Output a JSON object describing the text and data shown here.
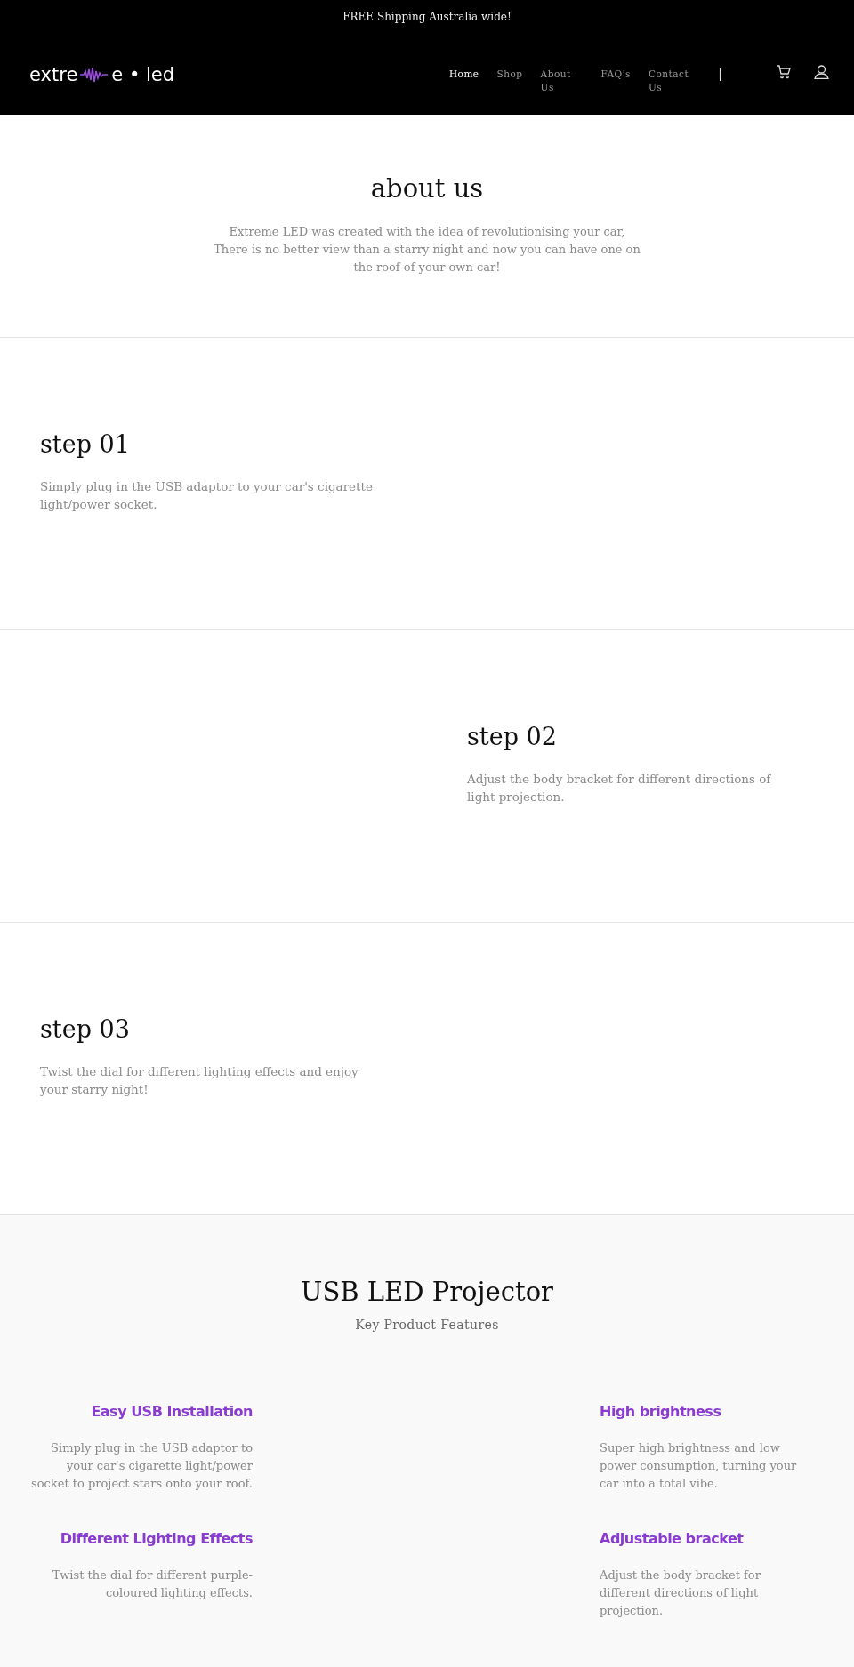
{
  "announcement": "FREE Shipping Australia wide!",
  "logo": {
    "before": "extre",
    "after": "e • led"
  },
  "nav": [
    {
      "label": "Home",
      "selected": true
    },
    {
      "label": "Shop",
      "selected": false
    },
    {
      "label": "About Us",
      "selected": false
    },
    {
      "label": "FAQ's",
      "selected": false
    },
    {
      "label": "Contact Us",
      "selected": false
    }
  ],
  "nav_separator": "|",
  "about": {
    "title": "about us",
    "text": "Extreme LED was created with the idea of revolutionising your car, There is no better view than a starry night and now you can have one on the roof of your own car!"
  },
  "steps": [
    {
      "title": "step 01",
      "text": "Simply plug in the USB adaptor to your car's cigarette light/power socket.",
      "kind": "left"
    },
    {
      "title": "step 02",
      "text": "Adjust the body bracket for different directions of light projection.",
      "kind": "right"
    },
    {
      "title": "step 03",
      "text": "Twist the dial for different lighting effects and enjoy your starry night!",
      "kind": "left"
    }
  ],
  "product": {
    "title": "USB LED Projector",
    "subtitle": "Key Product Features",
    "features": [
      {
        "title": "Easy USB Installation",
        "text": "Simply plug in the USB adaptor to your car's cigarette light/power socket to project stars onto your roof.",
        "kind": "left"
      },
      {
        "title": "High brightness",
        "text": "Super high brightness and low power consumption, turning your car into a total vibe.",
        "kind": "right"
      },
      {
        "title": "Different Lighting Effects",
        "text": "Twist the dial for different purple-coloured lighting effects.",
        "kind": "left"
      },
      {
        "title": "Adjustable bracket",
        "text": "Adjust the body bracket for different directions of light projection.",
        "kind": "right"
      }
    ]
  }
}
